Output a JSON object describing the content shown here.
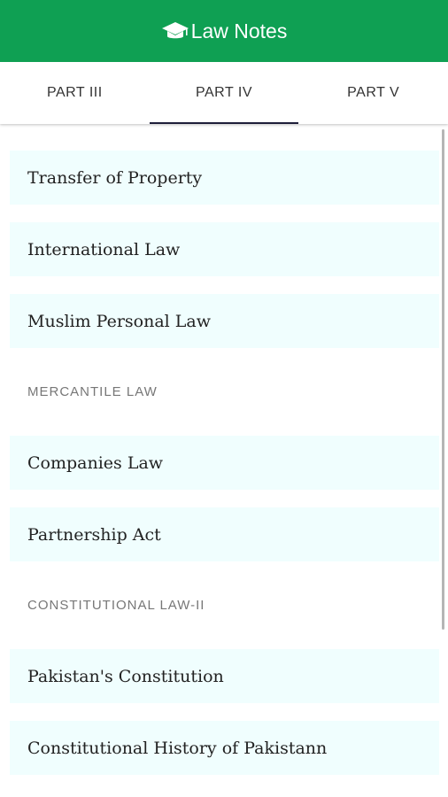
{
  "app_bar": {
    "title": "Law Notes",
    "icon": "graduation-cap-icon",
    "color": "#0fa053"
  },
  "tabs": [
    {
      "label": "PART III",
      "active": false
    },
    {
      "label": "PART IV",
      "active": true
    },
    {
      "label": "PART V",
      "active": false
    }
  ],
  "list": {
    "items": [
      "Transfer of Property",
      "International Law",
      "Muslim Personal Law",
      "Companies Law",
      "Partnership Act",
      "Pakistan's Constitution",
      "Constitutional History of Pakistann"
    ],
    "sections": [
      "MERCANTILE LAW",
      "CONSTITUTIONAL LAW-II"
    ],
    "item_background": "#f0fefe"
  }
}
